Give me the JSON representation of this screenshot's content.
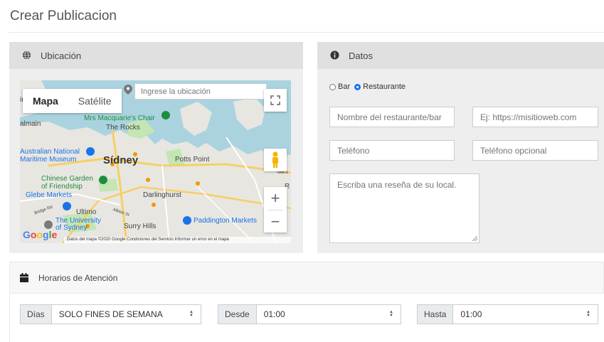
{
  "page": {
    "title": "Crear Publicacion"
  },
  "ubicacion": {
    "header": "Ubicación",
    "map": {
      "tab_map": "Mapa",
      "tab_satellite": "Satélite",
      "search_placeholder": "Ingrese la ubicación",
      "labels": {
        "chair": "Mrs Macquarie's Chair",
        "rocks": "The Rocks",
        "balmain": "almain",
        "museum": "Australian National\nMaritime Museum",
        "sydney": "Sídney",
        "potts": "Potts Point",
        "garden": "Chinese Garden\nof Friendship",
        "glebe": "Glebe Markets",
        "darling": "Darlinghurst",
        "ultimo": "Ultimo",
        "university": "The University\nof Sydney",
        "surry": "Surry Hills",
        "paddington": "Paddington Markets",
        "albion": "Albion St",
        "bridge": "Bridge Rd",
        "new_s": "New S",
        "r": "R",
        "in": "in"
      },
      "google": "Google",
      "footer": "Datos del mapa ©2020 Google   Condiciones del Servicio   Informar un error en el mapa"
    }
  },
  "datos": {
    "header": "Datos",
    "radio_bar": "Bar",
    "radio_restaurante": "Restaurante",
    "name_placeholder": "Nombre del restaurante/bar",
    "web_placeholder": "Ej: https://misitioweb.com",
    "phone_placeholder": "Teléfono",
    "phone2_placeholder": "Teléfono opcional",
    "review_placeholder": "Escriba una reseña de su local."
  },
  "horarios": {
    "header": "Horarios de Atención",
    "dias_label": "Días",
    "dias_value": "SOLO FINES DE SEMANA",
    "desde_label": "Desde",
    "desde_value": "01:00",
    "hasta_label": "Hasta",
    "hasta_value": "01:00"
  },
  "icons": {
    "globe": "globe-icon",
    "info": "info-icon",
    "calendar": "calendar-icon",
    "fullscreen": "fullscreen-icon",
    "pegman": "pegman-icon",
    "zoom_in": "plus-icon",
    "zoom_out": "minus-icon"
  }
}
